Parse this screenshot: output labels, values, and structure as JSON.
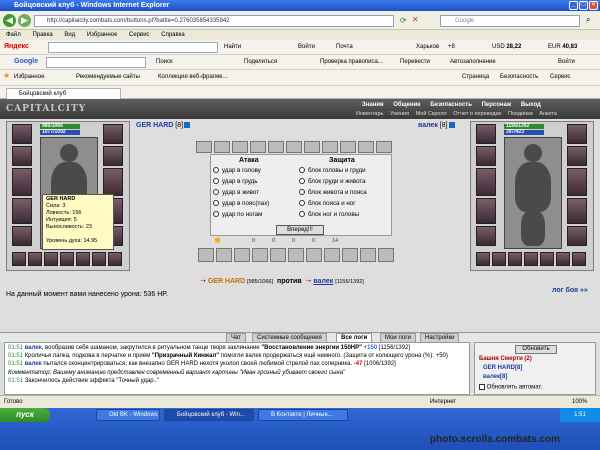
{
  "window": {
    "title": "Бойцовский клуб - Windows Internet Explorer"
  },
  "address": {
    "url": "http://capitalcity.combats.com/buttons.pl?battle=0.276035854335942",
    "search_placeholder": "Google"
  },
  "menu": [
    "Файл",
    "Правка",
    "Вид",
    "Избранное",
    "Сервис",
    "Справка"
  ],
  "yandex_bar": {
    "brand": "Яндекс",
    "find": "Найти",
    "login": "Войти",
    "mail": "Почта",
    "weather_city": "Харьков",
    "temp": "+8",
    "usd": "28,22",
    "eur": "40,83"
  },
  "google_bar": {
    "brand": "Google",
    "search": "Поиск",
    "share": "Поделиться",
    "spell": "Проверка правописа...",
    "translate": "Перевести",
    "autofill": "Автозаполнение",
    "login": "Войти"
  },
  "favorites_bar": {
    "fav": "Избранное",
    "recommended": "Рекомендуемые сайты",
    "collection": "Коллекция веб-фрагме...",
    "page": "Страница",
    "security": "Безопасность",
    "service": "Сервис"
  },
  "tab": {
    "label": "Бойцовский клуб"
  },
  "game_menu": {
    "top": [
      "Знания",
      "Общение",
      "Безопасность",
      "Персонаж",
      "Выход"
    ],
    "sub": [
      "Инвентарь",
      "Умения",
      "Мой Скролл",
      "Отчет о переводах",
      "Поединки",
      "Анкета"
    ]
  },
  "player_left": {
    "name": "GER HARD",
    "level": "[8]",
    "hp": "985/1066",
    "mana": "1077/1092"
  },
  "player_right": {
    "name": "валек",
    "level": "[8]",
    "hp": "1156/1392",
    "mana": "397/423"
  },
  "tooltip": {
    "name": "GER HARD",
    "lines": [
      "Сила: 3",
      "Ловкость: 156",
      "Интуиция: 5",
      "Выносливость: 23",
      "",
      "Уровень духа: 14.95"
    ]
  },
  "battle": {
    "attack_header": "Атака",
    "defense_header": "Защита",
    "attack": [
      "удар в голову",
      "удар в грудь",
      "удар в живот",
      "удар в пояс(пах)",
      "удар по ногам"
    ],
    "defense": [
      "блок головы и груди",
      "блок груди и живота",
      "блок живота и пояса",
      "блок пояса и ног",
      "блок ног и головы"
    ],
    "forward": "Вперед!!!",
    "stats": [
      "0",
      "0",
      "0",
      "0",
      "14"
    ]
  },
  "versus": {
    "left_name": "GER HARD",
    "left_hp": "[985/1066]",
    "word": "против",
    "right_name": "валек",
    "right_hp": "[1156/1392]"
  },
  "damage_text": "На данный момент вами нанесено урона: 536 HP.",
  "battle_log_link": "лог боя »»",
  "log_tabs": [
    "Чат",
    "Системные сообщения",
    "Все логи",
    "Мои логи",
    "Настройки"
  ],
  "log": [
    {
      "time": "01:51",
      "name": "валек",
      "text": ", вообразив себя шаманом, закрутился в ритуальном танце творя заклинание",
      "bold": "\"Восстановление энергии 150HP\"",
      "dmg": "+150",
      "tail": "[1156/1392]"
    },
    {
      "time": "01:51",
      "name": "",
      "text": "Кроличья лапка, подкова в перчатке и прием",
      "bold": "\"Призрачный Кинжал\"",
      "dmg": "",
      "tail": "помогли валек продержаться ещё немного. (Защита от колющего урона (%): +50)"
    },
    {
      "time": "01:51",
      "name": "валек",
      "text": "пытался сконцентрироваться, как внезапно GER HARD нехотя уколол своей любимой стрелой пах соперника.",
      "bold": "",
      "dmg": "-47",
      "tail": "[1006/1392]"
    },
    {
      "time": "",
      "name": "",
      "text": "Комментатор: Вашему вниманию представлен современный вариант картины \"Иван грозный убивает своего сына\"",
      "bold": "",
      "dmg": "",
      "tail": ""
    },
    {
      "time": "01:51",
      "name": "",
      "text": "Закончилось действие эффекта \"Точный удар..\"",
      "bold": "",
      "dmg": "",
      "tail": ""
    }
  ],
  "side": {
    "refresh": "Обновить",
    "tower": "Башня Смерти (2)",
    "members": [
      "GER HARD[8]",
      "валек[8]"
    ],
    "auto": "Обновлять автомат."
  },
  "statusbar": {
    "left": "Готово",
    "zone": "Интернет",
    "zoom": "100%"
  },
  "taskbar": {
    "start": "пуск",
    "tasks": [
      "Old BK - Windows Inte...",
      "Бойцовский клуб - Win...",
      "В Контакте | Личные..."
    ],
    "clock": "1:51"
  },
  "watermark": "photo.scrolls.combats.com"
}
